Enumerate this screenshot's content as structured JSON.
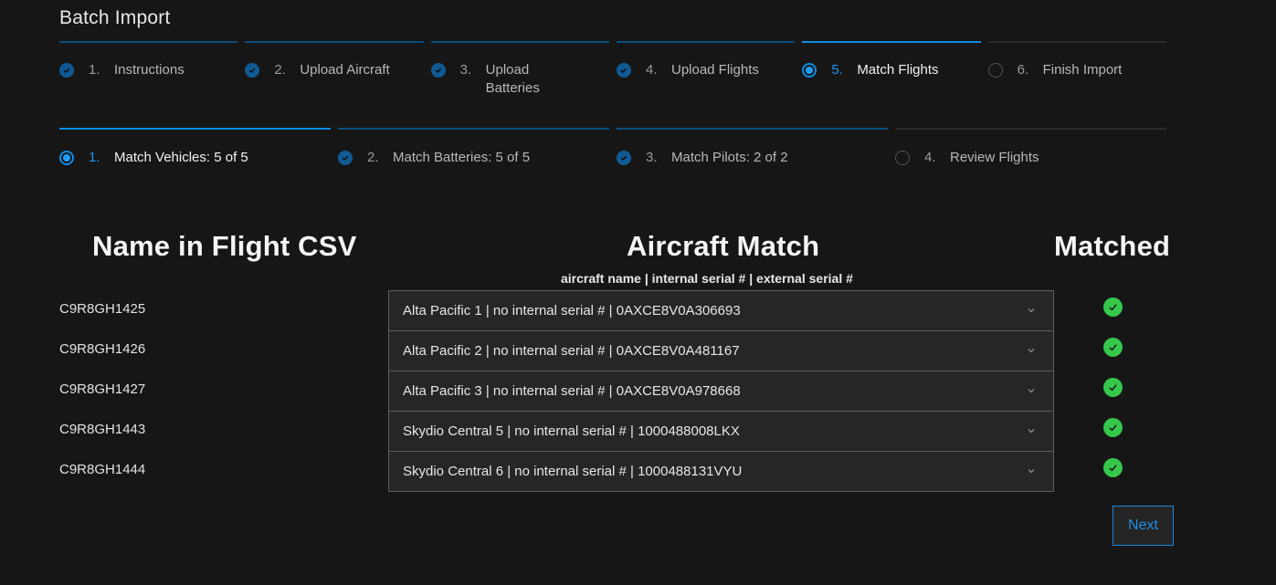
{
  "page": {
    "title": "Batch Import"
  },
  "main_steps": [
    {
      "num": "1.",
      "label": "Instructions",
      "status": "complete"
    },
    {
      "num": "2.",
      "label": "Upload Aircraft",
      "status": "complete"
    },
    {
      "num": "3.",
      "label": "Upload Batteries",
      "status": "complete"
    },
    {
      "num": "4.",
      "label": "Upload Flights",
      "status": "complete"
    },
    {
      "num": "5.",
      "label": "Match Flights",
      "status": "active"
    },
    {
      "num": "6.",
      "label": "Finish Import",
      "status": "pending"
    }
  ],
  "sub_steps": [
    {
      "num": "1.",
      "label": "Match Vehicles: 5 of 5",
      "status": "active"
    },
    {
      "num": "2.",
      "label": "Match Batteries: 5 of 5",
      "status": "complete"
    },
    {
      "num": "3.",
      "label": "Match Pilots: 2 of 2",
      "status": "complete"
    },
    {
      "num": "4.",
      "label": "Review Flights",
      "status": "pending"
    }
  ],
  "table": {
    "headers": {
      "name": "Name in Flight CSV",
      "match": "Aircraft Match",
      "match_sub": "aircraft name | internal serial # | external serial #",
      "matched": "Matched"
    },
    "rows": [
      {
        "csv_name": "C9R8GH1425",
        "match": "Alta Pacific 1 | no internal serial # | 0AXCE8V0A306693",
        "matched": true
      },
      {
        "csv_name": "C9R8GH1426",
        "match": "Alta Pacific 2 | no internal serial # | 0AXCE8V0A481167",
        "matched": true
      },
      {
        "csv_name": "C9R8GH1427",
        "match": "Alta Pacific 3 | no internal serial # | 0AXCE8V0A978668",
        "matched": true
      },
      {
        "csv_name": "C9R8GH1443",
        "match": "Skydio Central 5 | no internal serial # | 1000488008LKX",
        "matched": true
      },
      {
        "csv_name": "C9R8GH1444",
        "match": "Skydio Central 6 | no internal serial # | 1000488131VYU",
        "matched": true
      }
    ]
  },
  "actions": {
    "next_label": "Next"
  },
  "colors": {
    "accent": "#0b8de6",
    "complete": "#105a94",
    "success": "#35c84a",
    "background": "#161616"
  }
}
